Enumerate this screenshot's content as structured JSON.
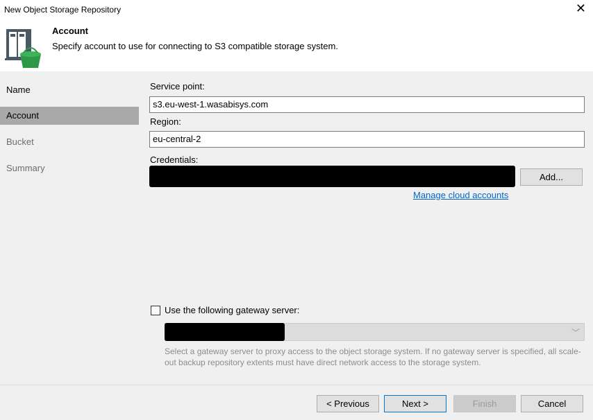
{
  "window": {
    "title": "New Object Storage Repository",
    "close_icon": "close-icon"
  },
  "header": {
    "title": "Account",
    "description": "Specify account to use for connecting to S3 compatible storage system.",
    "icon": "object-storage-repository-icon"
  },
  "steps": [
    {
      "label": "Name",
      "state": "done"
    },
    {
      "label": "Account",
      "state": "active"
    },
    {
      "label": "Bucket",
      "state": "pending"
    },
    {
      "label": "Summary",
      "state": "pending"
    }
  ],
  "form": {
    "service_point_label": "Service point:",
    "service_point_value": "s3.eu-west-1.wasabisys.com",
    "region_label": "Region:",
    "region_value": "eu-central-2",
    "credentials_label": "Credentials:",
    "credentials_value_redacted": true,
    "add_button": "Add...",
    "manage_link": "Manage cloud accounts",
    "gateway_checkbox_label": "Use the following gateway server:",
    "gateway_checked": false,
    "gateway_value_redacted": true,
    "gateway_note": "Select a gateway server to proxy access to the object storage system. If no gateway server is specified, all scale-out backup repository extents must have direct network access to the storage system."
  },
  "footer": {
    "previous": "< Previous",
    "next": "Next >",
    "finish": "Finish",
    "cancel": "Cancel"
  },
  "colors": {
    "active_step_bg": "#a9a9a9",
    "panel_bg": "#f0f0f0",
    "link": "#0066cc",
    "icon_green": "#2e9a47",
    "icon_slate": "#4a5966"
  }
}
